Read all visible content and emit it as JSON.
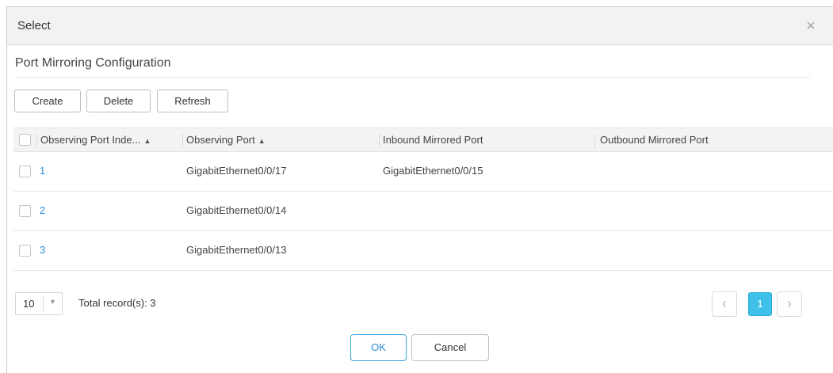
{
  "dialog": {
    "title": "Select",
    "close_icon": "close-icon",
    "close_glyph": "×"
  },
  "section": {
    "title": "Port Mirroring Configuration"
  },
  "toolbar": {
    "create_label": "Create",
    "delete_label": "Delete",
    "refresh_label": "Refresh"
  },
  "table": {
    "columns": [
      {
        "label": "Observing Port Inde...",
        "sortable": true,
        "sort_glyph": "▲"
      },
      {
        "label": "Observing Port",
        "sortable": true,
        "sort_glyph": "▲"
      },
      {
        "label": "Inbound Mirrored Port",
        "sortable": false
      },
      {
        "label": "Outbound Mirrored Port",
        "sortable": false
      }
    ],
    "rows": [
      {
        "index": "1",
        "observing_port": "GigabitEthernet0/0/17",
        "inbound": "GigabitEthernet0/0/15",
        "outbound": ""
      },
      {
        "index": "2",
        "observing_port": "GigabitEthernet0/0/14",
        "inbound": "",
        "outbound": ""
      },
      {
        "index": "3",
        "observing_port": "GigabitEthernet0/0/13",
        "inbound": "",
        "outbound": ""
      }
    ]
  },
  "pagination": {
    "page_size": "10",
    "total_text": "Total record(s): 3",
    "current_page": "1",
    "prev_glyph": "‹",
    "next_glyph": "›",
    "caret_glyph": "▼"
  },
  "footer": {
    "ok_label": "OK",
    "cancel_label": "Cancel"
  },
  "colors": {
    "accent": "#3fc0ea",
    "link": "#2a8bd6",
    "header_bg": "#f2f2f2"
  }
}
